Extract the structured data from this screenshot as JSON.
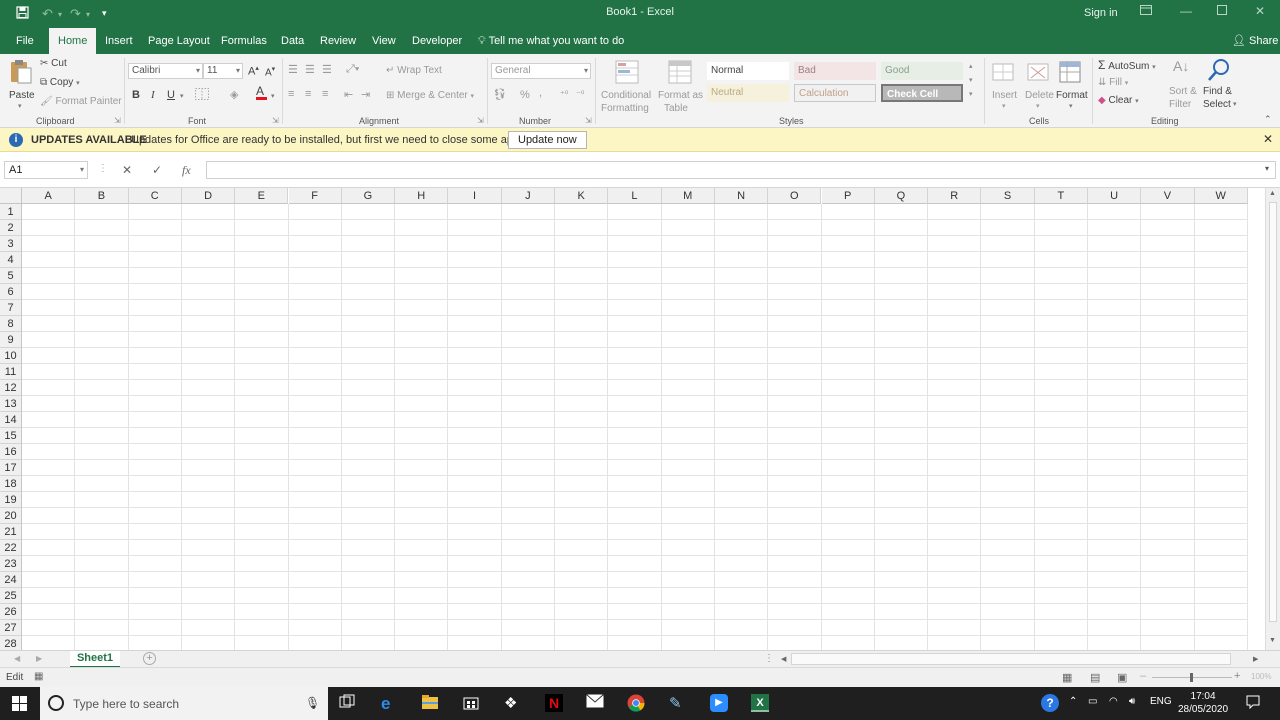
{
  "window": {
    "title": "Book1  -  Excel",
    "signin": "Sign in"
  },
  "tabs": [
    {
      "label": "File"
    },
    {
      "label": "Home"
    },
    {
      "label": "Insert"
    },
    {
      "label": "Page Layout"
    },
    {
      "label": "Formulas"
    },
    {
      "label": "Data"
    },
    {
      "label": "Review"
    },
    {
      "label": "View"
    },
    {
      "label": "Developer"
    }
  ],
  "tell_me": "Tell me what you want to do",
  "share": "Share",
  "ribbon": {
    "clipboard": {
      "paste": "Paste",
      "cut": "Cut",
      "copy": "Copy",
      "format_painter": "Format Painter",
      "label": "Clipboard"
    },
    "font": {
      "name": "Calibri",
      "size": "11",
      "bold": "B",
      "italic": "I",
      "underline": "U",
      "label": "Font"
    },
    "alignment": {
      "wrap_text": "Wrap Text",
      "merge_center": "Merge & Center",
      "label": "Alignment"
    },
    "number": {
      "format": "General",
      "percent": "%",
      "label": "Number"
    },
    "styles": {
      "conditional": "Conditional",
      "formatting": "Formatting",
      "format_as": "Format as",
      "table": "Table",
      "normal": "Normal",
      "bad": "Bad",
      "good": "Good",
      "neutral": "Neutral",
      "calculation": "Calculation",
      "check_cell": "Check Cell",
      "label": "Styles"
    },
    "cells": {
      "insert": "Insert",
      "delete": "Delete",
      "format": "Format",
      "label": "Cells"
    },
    "editing": {
      "autosum": "AutoSum",
      "fill": "Fill",
      "clear": "Clear",
      "sort": "Sort &",
      "filter": "Filter",
      "find": "Find &",
      "select": "Select",
      "label": "Editing"
    }
  },
  "updates": {
    "heading": "UPDATES AVAILABLE",
    "message": "Updates for Office are ready to be installed, but first we need to close some apps.",
    "button": "Update now"
  },
  "formula_bar": {
    "name_box": "A1",
    "fx": "fx"
  },
  "grid": {
    "columns": [
      "A",
      "B",
      "C",
      "D",
      "E",
      "F",
      "G",
      "H",
      "I",
      "J",
      "K",
      "L",
      "M",
      "N",
      "O",
      "P",
      "Q",
      "R",
      "S",
      "T",
      "U",
      "V",
      "W"
    ],
    "rows": [
      "1",
      "2",
      "3",
      "4",
      "5",
      "6",
      "7",
      "8",
      "9",
      "10",
      "11",
      "12",
      "13",
      "14",
      "15",
      "16",
      "17",
      "18",
      "19",
      "20",
      "21",
      "22",
      "23",
      "24",
      "25",
      "26",
      "27",
      "28"
    ]
  },
  "sheets": [
    {
      "name": "Sheet1"
    }
  ],
  "status": {
    "mode": "Edit",
    "zoom": "100%"
  },
  "taskbar": {
    "search_placeholder": "Type here to search",
    "lang": "ENG",
    "time": "17:04",
    "date": "28/05/2020"
  },
  "colors": {
    "excel_green": "#217346",
    "update_bar": "#fcf5c4"
  }
}
